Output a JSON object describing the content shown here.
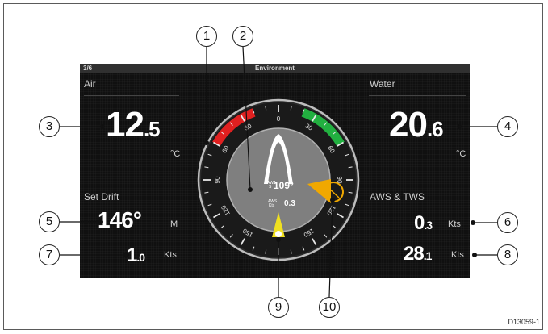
{
  "screen": {
    "page_indicator": "3/6",
    "title": "Environment"
  },
  "air": {
    "label": "Air",
    "value_int": "12",
    "value_dec": ".5",
    "unit": "°C"
  },
  "water": {
    "label": "Water",
    "value_int": "20",
    "value_dec": ".6",
    "unit": "°C"
  },
  "set_drift": {
    "label": "Set Drift",
    "set_value": "146°",
    "set_unit": "M",
    "drift_int": "1",
    "drift_dec": ".0",
    "drift_unit": "Kts"
  },
  "wind": {
    "label": "AWS & TWS",
    "aws_int": "0",
    "aws_dec": ".3",
    "aws_unit": "Kts",
    "tws_int": "28",
    "tws_dec": ".1",
    "tws_unit": "Kts"
  },
  "dial": {
    "awa_label": "AWA",
    "awa_sub": "S",
    "awa_value": "109°",
    "aws_label": "AWS",
    "aws_sub": "Kts",
    "aws_value": "0.3",
    "ticks": [
      "0",
      "30",
      "60",
      "90",
      "120",
      "150",
      "150",
      "120",
      "90",
      "60",
      "30"
    ],
    "colors": {
      "port": "#e02020",
      "starboard": "#22b040",
      "apparent_wind": "#f0a800",
      "true_wind": "#f0e020"
    }
  },
  "callouts": [
    "1",
    "2",
    "3",
    "4",
    "5",
    "6",
    "7",
    "8",
    "9",
    "10"
  ],
  "figure_id": "D13059-1"
}
